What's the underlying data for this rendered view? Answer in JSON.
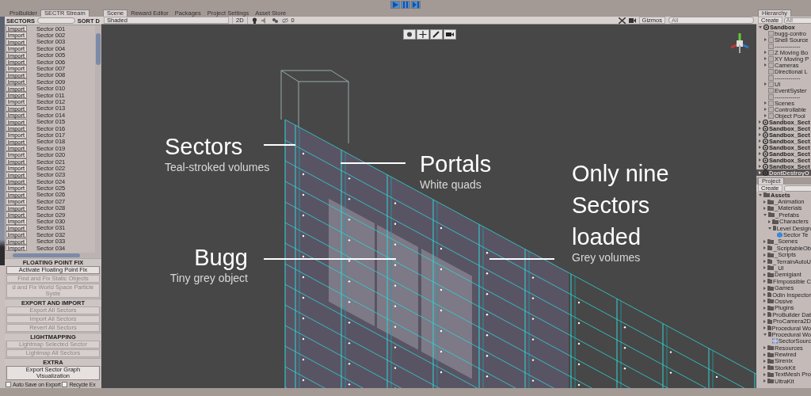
{
  "left_tabs": [
    {
      "label": "ProBuilder",
      "selected": false
    },
    {
      "label": "SECTR Stream",
      "selected": true
    }
  ],
  "sectors_panel": {
    "title": "SECTORS",
    "sort_label": "SORT D",
    "rows": [
      {
        "button": "Import",
        "name": "Sector 001"
      },
      {
        "button": "Import",
        "name": "Sector 002"
      },
      {
        "button": "Import",
        "name": "Sector 003"
      },
      {
        "button": "Import",
        "name": "Sector 004"
      },
      {
        "button": "Import",
        "name": "Sector 005"
      },
      {
        "button": "Import",
        "name": "Sector 006"
      },
      {
        "button": "Import",
        "name": "Sector 007"
      },
      {
        "button": "Import",
        "name": "Sector 008"
      },
      {
        "button": "Import",
        "name": "Sector 009"
      },
      {
        "button": "Import",
        "name": "Sector 010"
      },
      {
        "button": "Import",
        "name": "Sector 011"
      },
      {
        "button": "Import",
        "name": "Sector 012"
      },
      {
        "button": "Import",
        "name": "Sector 013"
      },
      {
        "button": "Import",
        "name": "Sector 014"
      },
      {
        "button": "Import",
        "name": "Sector 015"
      },
      {
        "button": "Import",
        "name": "Sector 016"
      },
      {
        "button": "Import",
        "name": "Sector 017"
      },
      {
        "button": "Import",
        "name": "Sector 018"
      },
      {
        "button": "Import",
        "name": "Sector 019"
      },
      {
        "button": "Import",
        "name": "Sector 020"
      },
      {
        "button": "Import",
        "name": "Sector 021"
      },
      {
        "button": "Import",
        "name": "Sector 022"
      },
      {
        "button": "Import",
        "name": "Sector 023"
      },
      {
        "button": "Import",
        "name": "Sector 024"
      },
      {
        "button": "Import",
        "name": "Sector 025"
      },
      {
        "button": "Import",
        "name": "Sector 026"
      },
      {
        "button": "Import",
        "name": "Sector 027"
      },
      {
        "button": "Import",
        "name": "Sector 028"
      },
      {
        "button": "Import",
        "name": "Sector 029"
      },
      {
        "button": "Import",
        "name": "Sector 030"
      },
      {
        "button": "Import",
        "name": "Sector 031"
      },
      {
        "button": "Import",
        "name": "Sector 032"
      },
      {
        "button": "Import",
        "name": "Sector 033"
      },
      {
        "button": "Import",
        "name": "Sector 034"
      }
    ],
    "sections": [
      {
        "title": "FLOATING POINT FIX",
        "buttons": [
          {
            "label": "Activate Floating Point Fix",
            "disabled": false
          },
          {
            "label": "Find and Fix Static Objects",
            "disabled": true
          },
          {
            "label": "d and Fix World Space Particle Syste",
            "disabled": true
          }
        ]
      },
      {
        "title": "EXPORT AND IMPORT",
        "buttons": [
          {
            "label": "Export All Sectors",
            "disabled": true
          },
          {
            "label": "Import All Sectors",
            "disabled": true
          },
          {
            "label": "Revert All Sectors",
            "disabled": true
          }
        ]
      },
      {
        "title": "LIGHTMAPPING",
        "buttons": [
          {
            "label": "Lightmap Selected Sector",
            "disabled": true
          },
          {
            "label": "Lightmap All Sectors",
            "disabled": true
          }
        ]
      },
      {
        "title": "EXTRA",
        "buttons": [
          {
            "label": "Export Sector Graph Visualization",
            "disabled": false
          }
        ]
      }
    ],
    "checkboxes": [
      {
        "label": "Auto Save on Export",
        "checked": false
      },
      {
        "label": "Recycle Ex",
        "checked": false
      }
    ]
  },
  "scene_tabs": [
    {
      "label": "Scene",
      "selected": true
    },
    {
      "label": "Reward Editor",
      "selected": false
    },
    {
      "label": "Packages",
      "selected": false
    },
    {
      "label": "Project Settings",
      "selected": false
    },
    {
      "label": "Asset Store",
      "selected": false
    }
  ],
  "scene_toolbar": {
    "shading": "Shaded",
    "mode": "2D",
    "hidden_count": "0",
    "gizmos": "Gizmos",
    "search_placeholder": "All"
  },
  "annotations": [
    {
      "title": "Sectors",
      "caption": "Teal-stroked volumes"
    },
    {
      "title": "Portals",
      "caption": "White quads"
    },
    {
      "title": "Bugg",
      "caption": "Tiny grey object"
    },
    {
      "title": "Only nine Sectors loaded",
      "caption": "Grey volumes"
    }
  ],
  "hierarchy": {
    "title": "Hierarchy",
    "create": "Create",
    "search_placeholder": "All",
    "items": [
      {
        "label": "Sandbox",
        "kind": "scene",
        "expanded": true,
        "selected": false,
        "children": [
          {
            "label": "bugg-contro",
            "kind": "object",
            "selected": false
          },
          {
            "label": "Shell Source",
            "kind": "object",
            "expanded": false,
            "selected": false
          },
          {
            "label": "-------------",
            "kind": "object",
            "selected": false
          },
          {
            "label": "Z Moving Bo",
            "kind": "object",
            "expanded": false,
            "selected": false
          },
          {
            "label": "XY Moving P",
            "kind": "object",
            "expanded": false,
            "selected": false
          },
          {
            "label": "Cameras",
            "kind": "object",
            "expanded": false,
            "selected": false
          },
          {
            "label": "Directional L",
            "kind": "object",
            "selected": false
          },
          {
            "label": "-------------",
            "kind": "object",
            "selected": false
          },
          {
            "label": "UI",
            "kind": "object",
            "expanded": false,
            "selected": false
          },
          {
            "label": "EventSyster",
            "kind": "object",
            "selected": false
          },
          {
            "label": "-------------",
            "kind": "object",
            "selected": false
          },
          {
            "label": "Scenes",
            "kind": "object",
            "expanded": false,
            "selected": false
          },
          {
            "label": "Controllable",
            "kind": "object",
            "expanded": false,
            "selected": false
          },
          {
            "label": "Object Pool",
            "kind": "object",
            "expanded": false,
            "selected": false
          }
        ]
      },
      {
        "label": "Sandbox_Sect",
        "kind": "scene",
        "expanded": false,
        "selected": false
      },
      {
        "label": "Sandbox_Sect",
        "kind": "scene",
        "expanded": false,
        "selected": false
      },
      {
        "label": "Sandbox_Sect",
        "kind": "scene",
        "expanded": false,
        "selected": false
      },
      {
        "label": "Sandbox_Sect",
        "kind": "scene",
        "expanded": false,
        "selected": false
      },
      {
        "label": "Sandbox_Sect",
        "kind": "scene",
        "expanded": false,
        "selected": false
      },
      {
        "label": "Sandbox_Sect",
        "kind": "scene",
        "expanded": false,
        "selected": false
      },
      {
        "label": "Sandbox_Sect",
        "kind": "scene",
        "expanded": false,
        "selected": false
      },
      {
        "label": "Sandbox_Sect",
        "kind": "scene",
        "expanded": false,
        "selected": false
      },
      {
        "label": "DontDestroyO",
        "kind": "scene",
        "expanded": false,
        "selected": true
      }
    ]
  },
  "project": {
    "title": "Project",
    "create": "Create",
    "items": [
      {
        "label": "Assets",
        "kind": "folder",
        "expanded": true,
        "children": [
          {
            "label": "_Animation",
            "kind": "folder",
            "expanded": false
          },
          {
            "label": "_Materials",
            "kind": "folder",
            "expanded": false
          },
          {
            "label": "_Prefabs",
            "kind": "folder",
            "expanded": true,
            "children": [
              {
                "label": "Characters",
                "kind": "folder",
                "expanded": false
              },
              {
                "label": "Level Design",
                "kind": "folder",
                "expanded": true,
                "children": [
                  {
                    "label": "Sector Te",
                    "kind": "prefab"
                  }
                ]
              }
            ]
          },
          {
            "label": "_Scenes",
            "kind": "folder",
            "expanded": false
          },
          {
            "label": "_ScriptableOb",
            "kind": "folder",
            "expanded": false
          },
          {
            "label": "_Scripts",
            "kind": "folder",
            "expanded": false
          },
          {
            "label": "_TerrainAutoU",
            "kind": "folder",
            "expanded": false
          },
          {
            "label": "_UI",
            "kind": "folder",
            "expanded": false
          },
          {
            "label": "Demigiant",
            "kind": "folder",
            "expanded": false
          },
          {
            "label": "FImpossible C",
            "kind": "folder",
            "expanded": false
          },
          {
            "label": "Games",
            "kind": "folder",
            "expanded": false
          },
          {
            "label": "Odin Inspector",
            "kind": "folder",
            "expanded": false
          },
          {
            "label": "Ossive",
            "kind": "folder",
            "expanded": false
          },
          {
            "label": "Plugins",
            "kind": "folder",
            "expanded": false
          },
          {
            "label": "ProBuilder Dat",
            "kind": "folder",
            "expanded": false
          },
          {
            "label": "ProCamera2D",
            "kind": "folder",
            "expanded": false
          },
          {
            "label": "Procedural Wo",
            "kind": "folder",
            "expanded": false
          },
          {
            "label": "Procedural Wo",
            "kind": "folder",
            "expanded": true,
            "children": [
              {
                "label": "SectorSourc",
                "kind": "asset"
              }
            ]
          },
          {
            "label": "Resources",
            "kind": "folder",
            "expanded": false
          },
          {
            "label": "Rewired",
            "kind": "folder",
            "expanded": false
          },
          {
            "label": "Sirenix",
            "kind": "folder",
            "expanded": false
          },
          {
            "label": "StorkKit",
            "kind": "folder",
            "expanded": false
          },
          {
            "label": "TextMesh Pro",
            "kind": "folder",
            "expanded": false
          },
          {
            "label": "UltraKit",
            "kind": "folder",
            "expanded": false
          }
        ]
      }
    ]
  }
}
